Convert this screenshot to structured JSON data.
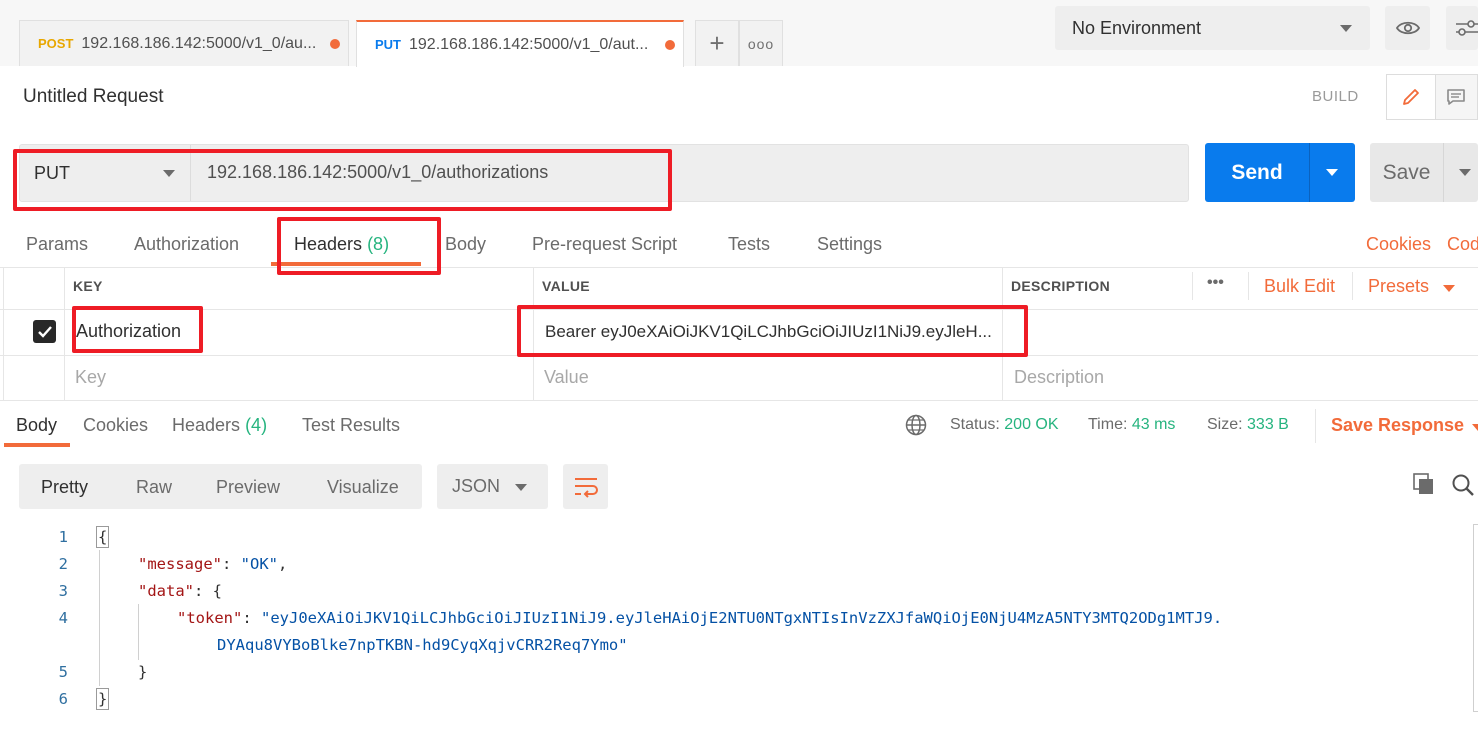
{
  "tabs": [
    {
      "method": "POST",
      "title": "192.168.186.142:5000/v1_0/au..."
    },
    {
      "method": "PUT",
      "title": "192.168.186.142:5000/v1_0/aut..."
    }
  ],
  "environment": {
    "selected": "No Environment"
  },
  "request": {
    "title": "Untitled Request",
    "build_label": "BUILD",
    "method": "PUT",
    "url": "192.168.186.142:5000/v1_0/authorizations",
    "send_label": "Send",
    "save_label": "Save"
  },
  "request_tabs": {
    "params": "Params",
    "authorization": "Authorization",
    "headers": "Headers",
    "headers_count": "(8)",
    "body": "Body",
    "prerequest": "Pre-request Script",
    "tests": "Tests",
    "settings": "Settings",
    "cookies": "Cookies",
    "code": "Cod"
  },
  "headers_table": {
    "columns": {
      "key": "KEY",
      "value": "VALUE",
      "description": "DESCRIPTION"
    },
    "more": "•••",
    "bulk_edit": "Bulk Edit",
    "presets": "Presets",
    "rows": [
      {
        "checked": true,
        "key": "Authorization",
        "value": "Bearer eyJ0eXAiOiJKV1QiLCJhbGciOiJIUzI1NiJ9.eyJleH...",
        "description": ""
      }
    ],
    "placeholders": {
      "key": "Key",
      "value": "Value",
      "description": "Description"
    }
  },
  "response": {
    "tabs": {
      "body": "Body",
      "cookies": "Cookies",
      "headers": "Headers",
      "headers_count": "(4)",
      "test_results": "Test Results"
    },
    "status_label": "Status:",
    "status_value": "200 OK",
    "time_label": "Time:",
    "time_value": "43 ms",
    "size_label": "Size:",
    "size_value": "333 B",
    "save_response": "Save Response",
    "formats": {
      "pretty": "Pretty",
      "raw": "Raw",
      "preview": "Preview",
      "visualize": "Visualize"
    },
    "language": "JSON",
    "line_numbers": [
      "1",
      "2",
      "3",
      "4",
      "5",
      "6"
    ],
    "code": {
      "open_brace": "{",
      "message_key": "\"message\"",
      "message_value": "\"OK\"",
      "data_key": "\"data\"",
      "token_key": "\"token\"",
      "token_value_1": "\"eyJ0eXAiOiJKV1QiLCJhbGciOiJIUzI1NiJ9.eyJleHAiOjE2NTU0NTgxNTIsInVzZXJfaWQiOjE0NjU4MzA5NTY3MTQ2ODg1MTJ9.",
      "token_value_2": "DYAqu8VYBoBlke7npTKBN-hd9CyqXqjvCRR2Req7Ymo\"",
      "close_inner": "}",
      "close_outer": "}"
    }
  },
  "colors": {
    "accent": "#f26b3a",
    "send": "#097bed",
    "success": "#26b47f",
    "highlight_box": "#ee1c25"
  }
}
